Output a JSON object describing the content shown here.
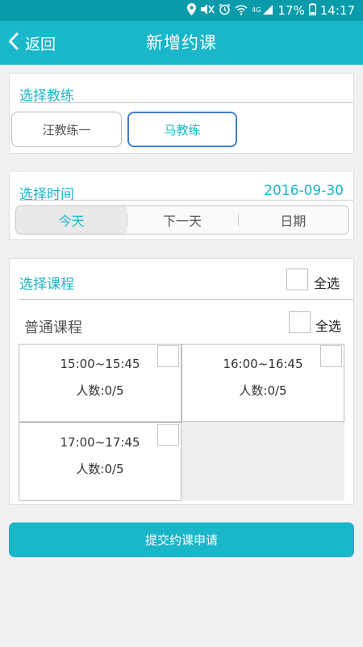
{
  "status_bar": {
    "battery": "17%",
    "time": "14:17",
    "network": "4G",
    "icons": [
      "location-icon",
      "mute-icon",
      "alarm-icon",
      "wifi-icon",
      "signal-icon",
      "battery-icon"
    ]
  },
  "nav": {
    "back_label": "返回",
    "title": "新增约课"
  },
  "coach_section": {
    "title": "选择教练",
    "coaches": [
      {
        "name": "汪教练一",
        "selected": false
      },
      {
        "name": "马教练",
        "selected": true
      }
    ]
  },
  "time_section": {
    "title": "选择时间",
    "date": "2016-09-30",
    "options": [
      {
        "label": "今天",
        "active": true
      },
      {
        "label": "下一天",
        "active": false
      },
      {
        "label": "日期",
        "active": false
      }
    ]
  },
  "course_section": {
    "title": "选择课程",
    "select_all": "全选",
    "category": "普通课程",
    "category_select_all": "全选",
    "sessions": [
      {
        "time": "15:00~15:45",
        "count": "人数:0/5"
      },
      {
        "time": "16:00~16:45",
        "count": "人数:0/5"
      },
      {
        "time": "17:00~17:45",
        "count": "人数:0/5"
      }
    ]
  },
  "submit_label": "提交约课申请",
  "colors": {
    "primary": "#1ab6c9",
    "status_bar": "#0a9bab",
    "selected_border": "#3d7ed0",
    "background": "#f1f0f2"
  }
}
